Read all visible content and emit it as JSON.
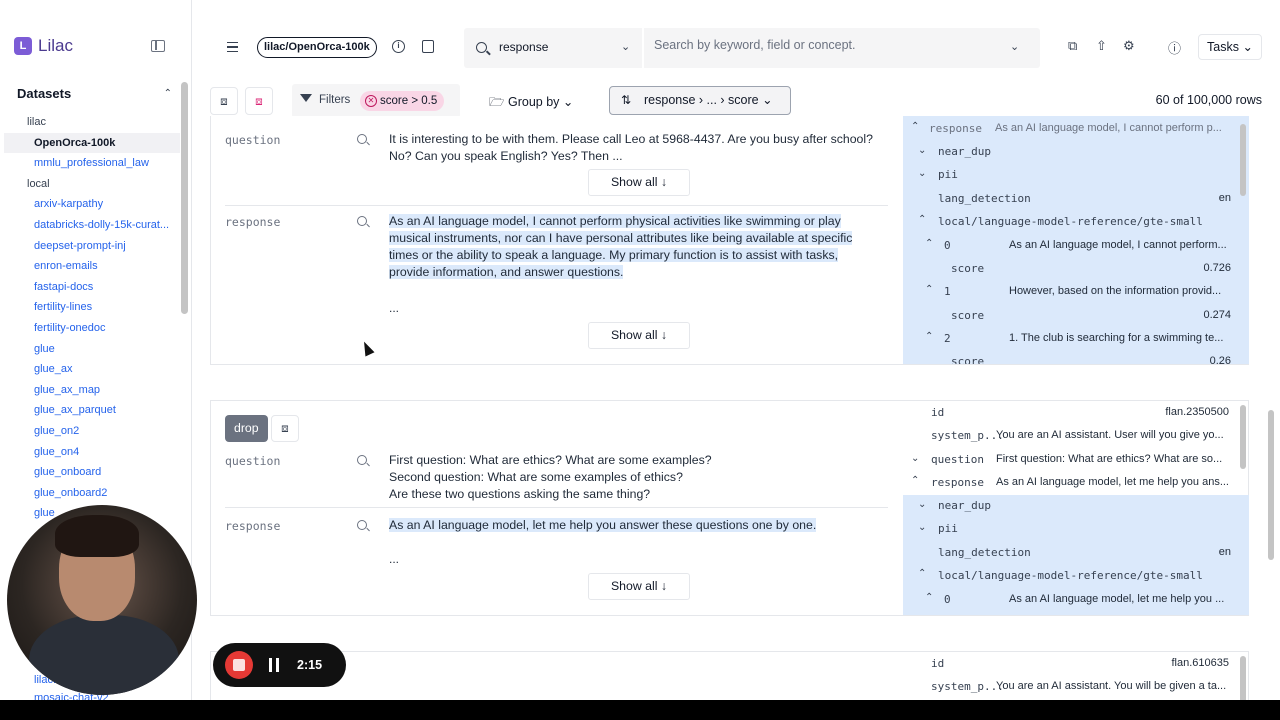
{
  "brand": {
    "name": "Lilac",
    "logo_glyph": "L"
  },
  "sidebar": {
    "section_title": "Datasets",
    "groups": [
      {
        "label": "lilac",
        "items": [
          "OpenOrca-100k",
          "mmlu_professional_law"
        ]
      },
      {
        "label": "local",
        "items": [
          "arxiv-karpathy",
          "databricks-dolly-15k-curat...",
          "deepset-prompt-inj",
          "enron-emails",
          "fastapi-docs",
          "fertility-lines",
          "fertility-onedoc",
          "glue",
          "glue_ax",
          "glue_ax_map",
          "glue_ax_parquet",
          "glue_on2",
          "glue_on4",
          "glue_onboard",
          "glue_onboard2",
          "glue_..."
        ]
      }
    ],
    "active_item": "OpenOrca-100k",
    "bottom_items": [
      "lilac...",
      "mosaic-chat-v2"
    ]
  },
  "header": {
    "dataset_pill": "lilac/OpenOrca-100k",
    "search_field": "response",
    "search_placeholder": "Search by keyword, field or concept.",
    "tasks_label": "Tasks"
  },
  "toolbar": {
    "filters_label": "Filters",
    "filter_chip": "score > 0.5",
    "group_by_label": "Group by",
    "sort_label": "response › ... › score",
    "row_count": "60 of 100,000 rows"
  },
  "rows": [
    {
      "fields": [
        {
          "name": "question",
          "value": "It is interesting to be with them. Please call Leo at 5968-4437. Are you busy after school? No? Can you speak English? Yes? Then ...",
          "show_all": "Show all"
        },
        {
          "name": "response",
          "value": "As an AI language model, I cannot perform physical activities like swimming or play musical instruments, nor can I have personal attributes like being available at specific times or the ability to speak a language. My primary function is to assist with tasks, provide information, and answer questions.",
          "ellipsis": "...",
          "show_all": "Show all"
        }
      ],
      "meta": [
        {
          "key": "response",
          "value": "As an AI language model, I cannot perform p...",
          "caret": "^"
        },
        {
          "key": "near_dup",
          "caret": "v"
        },
        {
          "key": "pii",
          "caret": "v"
        },
        {
          "key": "lang_detection",
          "value": "en"
        },
        {
          "key": "local/language-model-reference/gte-small",
          "caret": "^"
        },
        {
          "key": "0",
          "value": "As an AI language model, I cannot perform...",
          "caret": "^"
        },
        {
          "key": "score",
          "value": "0.726"
        },
        {
          "key": "1",
          "value": "However, based on the information provid...",
          "caret": "^"
        },
        {
          "key": "score",
          "value": "0.274"
        },
        {
          "key": "2",
          "value": "1. The club is searching for a swimming te...",
          "caret": "^"
        },
        {
          "key": "score",
          "value": "0.26"
        }
      ]
    },
    {
      "label": "drop",
      "fields": [
        {
          "name": "question",
          "value": "First question: What are ethics? What are some examples?\nSecond question: What are some examples of ethics?\nAre these two questions asking the same thing?"
        },
        {
          "name": "response",
          "value": "As an AI language model, let me help you answer these questions one by one.",
          "ellipsis": "...",
          "show_all": "Show all"
        }
      ],
      "meta": [
        {
          "key": "id",
          "value": "flan.2350500"
        },
        {
          "key": "system_p...",
          "value": "You are an AI assistant. User will you give yo..."
        },
        {
          "key": "question",
          "value": "First question: What are ethics? What are so...",
          "caret": "v"
        },
        {
          "key": "response",
          "value": "As an AI language model, let me help you ans...",
          "caret": "^"
        },
        {
          "key": "near_dup",
          "caret": "v"
        },
        {
          "key": "pii",
          "caret": "v"
        },
        {
          "key": "lang_detection",
          "value": "en"
        },
        {
          "key": "local/language-model-reference/gte-small",
          "caret": "^"
        },
        {
          "key": "0",
          "value": "As an AI language model, let me help you ...",
          "caret": "^"
        }
      ]
    },
    {
      "meta": [
        {
          "key": "id",
          "value": "flan.610635"
        },
        {
          "key": "system_p...",
          "value": "You are an AI assistant. You will be given a ta..."
        }
      ]
    }
  ],
  "recorder": {
    "time": "2:15"
  },
  "icons": {
    "sidebar_toggle": "sidebar-toggle-icon",
    "menu": "hamburger-icon",
    "info": "info-icon",
    "database": "database-icon",
    "search": "search-icon",
    "share": "share-icon",
    "upload": "upload-icon",
    "settings": "gear-icon",
    "help": "help-icon",
    "tag": "tag-icon",
    "filter": "filter-icon",
    "folder": "folder-icon",
    "sort": "sort-icon"
  },
  "colors": {
    "accent": "#7c5cd6",
    "highlight": "#dbe9fb",
    "chip": "#f9d6e6",
    "link": "#2563eb"
  }
}
